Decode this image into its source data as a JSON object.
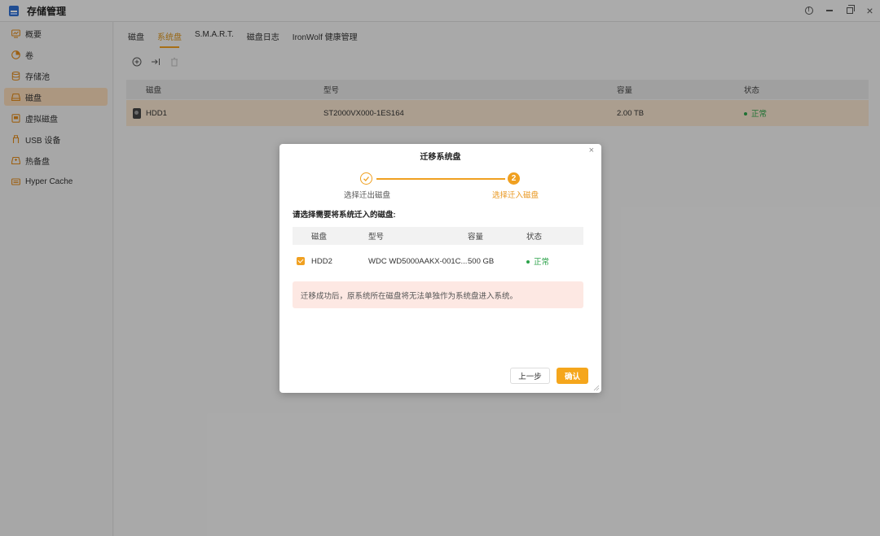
{
  "window": {
    "title": "存储管理"
  },
  "sidebar": {
    "items": [
      {
        "label": "概要",
        "icon": "overview-icon"
      },
      {
        "label": "卷",
        "icon": "volume-icon"
      },
      {
        "label": "存储池",
        "icon": "storage-pool-icon"
      },
      {
        "label": "磁盘",
        "icon": "disk-icon",
        "active": true
      },
      {
        "label": "虚拟磁盘",
        "icon": "virtual-disk-icon"
      },
      {
        "label": "USB 设备",
        "icon": "usb-icon"
      },
      {
        "label": "热备盘",
        "icon": "hot-spare-icon"
      },
      {
        "label": "Hyper Cache",
        "icon": "cache-icon"
      }
    ]
  },
  "tabs": [
    {
      "label": "磁盘"
    },
    {
      "label": "系统盘",
      "active": true
    },
    {
      "label": "S.M.A.R.T."
    },
    {
      "label": "磁盘日志"
    },
    {
      "label": "IronWolf 健康管理"
    }
  ],
  "table": {
    "headers": [
      "磁盘",
      "型号",
      "容量",
      "状态"
    ],
    "rows": [
      {
        "disk": "HDD1",
        "model": "ST2000VX000-1ES164",
        "capacity": "2.00 TB",
        "status": "正常"
      }
    ]
  },
  "dialog": {
    "title": "迁移系统盘",
    "steps": [
      {
        "label": "选择迁出磁盘",
        "state": "done"
      },
      {
        "number": "2",
        "label": "选择迁入磁盘",
        "state": "active"
      }
    ],
    "prompt": "请选择需要将系统迁入的磁盘:",
    "table": {
      "headers": [
        "磁盘",
        "型号",
        "容量",
        "状态"
      ],
      "rows": [
        {
          "checked": true,
          "disk": "HDD2",
          "model": "WDC WD5000AAKX-001C...",
          "capacity": "500 GB",
          "status": "正常"
        }
      ]
    },
    "warning": "迁移成功后，原系统所在磁盘将无法单独作为系统盘进入系统。",
    "buttons": {
      "prev": "上一步",
      "confirm": "确认"
    }
  },
  "colors": {
    "accent": "#f0a020",
    "status_ok": "#2ca24a",
    "warning_bg": "#fde8e3",
    "active_row": "#f5e3cd"
  }
}
